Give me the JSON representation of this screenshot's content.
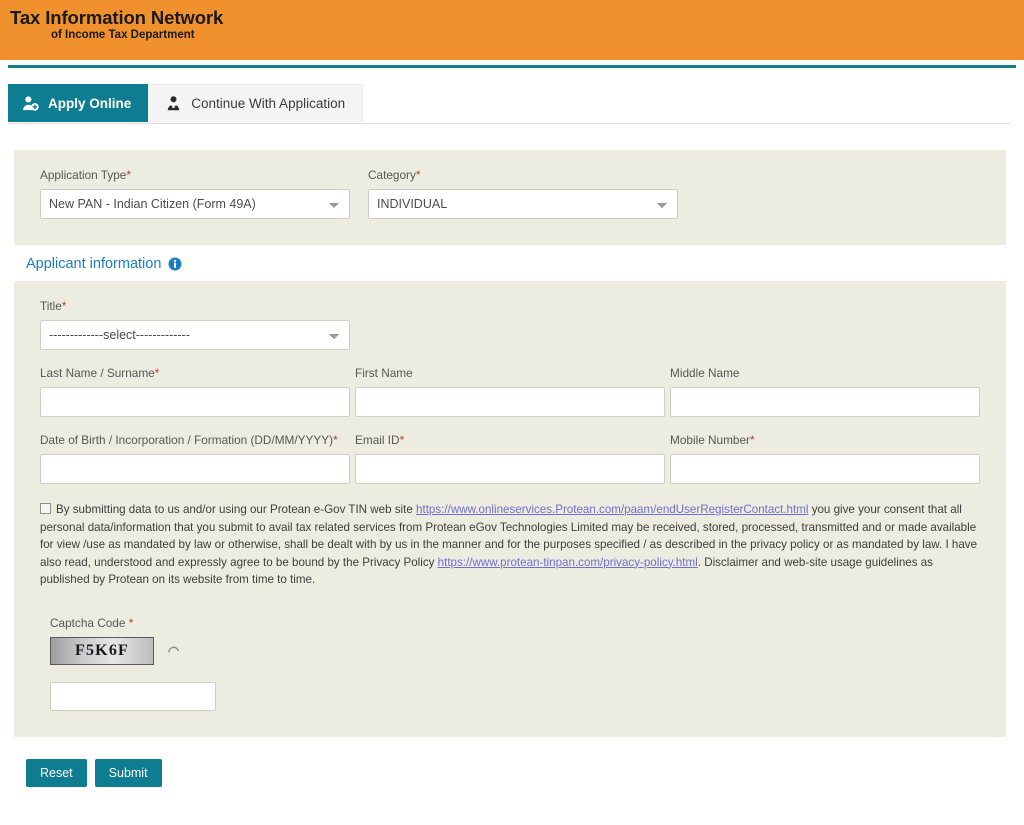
{
  "header": {
    "logo_line1": "Tax Information Network",
    "logo_line2": "of Income Tax Department",
    "accent_color": "#f0912d",
    "rule_color": "#137b8b"
  },
  "tabs": [
    {
      "label": "Apply Online",
      "icon": "user-add-icon",
      "active": true
    },
    {
      "label": "Continue With Application",
      "icon": "user-upload-icon",
      "active": false
    }
  ],
  "application": {
    "application_type_label": "Application Type",
    "application_type_value": "New PAN - Indian Citizen (Form 49A)",
    "category_label": "Category",
    "category_value": "INDIVIDUAL",
    "required_mark": "*"
  },
  "applicant_section": {
    "heading": "Applicant information",
    "info_icon": "info-circle-icon",
    "heading_color": "#1b7fbf",
    "title_label": "Title",
    "title_value": "-------------select-------------",
    "last_name_label": "Last Name / Surname",
    "last_name_value": "",
    "first_name_label": "First Name",
    "first_name_value": "",
    "middle_name_label": "Middle Name",
    "middle_name_value": "",
    "dob_label": "Date of Birth / Incorporation / Formation (DD/MM/YYYY)",
    "dob_value": "",
    "email_label": "Email ID",
    "email_value": "",
    "mobile_label": "Mobile Number",
    "mobile_value": ""
  },
  "consent": {
    "checked": false,
    "part1": "By submitting data to us and/or using our Protean e-Gov TIN web site ",
    "link1_text": "https://www.onlineservices.Protean.com/paam/endUserRegisterContact.html",
    "part2": " you give your consent that all personal data/information that you submit to avail tax related services from Protean eGov Technologies Limited may be received, stored, processed, transmitted and or made available for view /use as mandated by law or otherwise, shall be dealt with by us in the manner and for the purposes specified / as described in the privacy policy or as mandated by law. I have also read, understood and expressly agree to be bound by the Privacy Policy ",
    "link2_text": "https://www.protean-tinpan.com/privacy-policy.html",
    "part3": ". Disclaimer and web-site usage guidelines as published by Protean on its website from time to time.",
    "link_color": "#6f6fcf"
  },
  "captcha": {
    "label": "Captcha Code",
    "required_mark": "*",
    "code_text": "F5K6F",
    "refresh_icon": "refresh-icon",
    "input_value": ""
  },
  "buttons": {
    "reset_label": "Reset",
    "submit_label": "Submit",
    "color": "#0e7c91"
  }
}
